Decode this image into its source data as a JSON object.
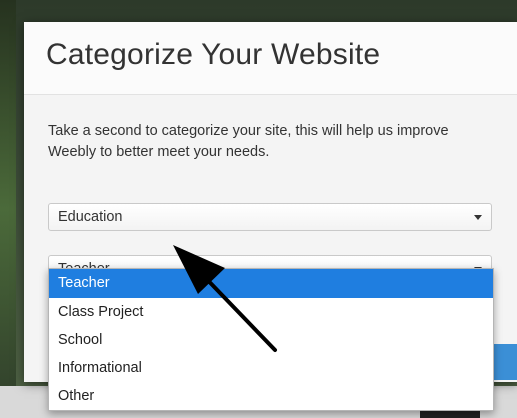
{
  "modal": {
    "title": "Categorize Your Website",
    "intro": "Take a second to categorize your site, this will help us improve Weebly to better meet your needs."
  },
  "category_select": {
    "value": "Education"
  },
  "subcategory_select": {
    "value": "Teacher",
    "options": [
      {
        "label": "Teacher",
        "selected": true
      },
      {
        "label": "Class Project",
        "selected": false
      },
      {
        "label": "School",
        "selected": false
      },
      {
        "label": "Informational",
        "selected": false
      },
      {
        "label": "Other",
        "selected": false
      }
    ]
  },
  "colors": {
    "highlight": "#1f7ee0",
    "arrow": "#000000"
  },
  "icons": {
    "select_caret": "caret-down-icon",
    "annotation": "pointer-arrow-icon"
  }
}
